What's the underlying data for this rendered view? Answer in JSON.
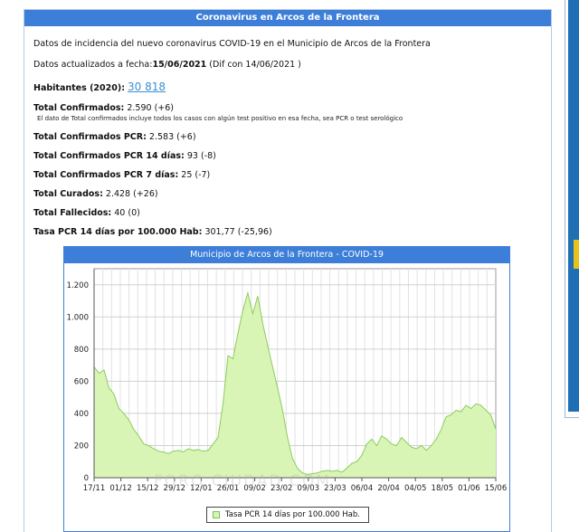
{
  "panel": {
    "title": "Coronavirus en Arcos de la Frontera"
  },
  "info": {
    "description": "Datos de incidencia del nuevo coronavirus COVID-19 en el Municipio de Arcos de la Frontera",
    "updated_label": "Datos actualizados a fecha:",
    "updated_date": "15/06/2021",
    "updated_diff": " (Dif con 14/06/2021 )",
    "population_label": "Habitantes (2020):",
    "population_value": "30 818"
  },
  "stats": {
    "total_confirmed_label": "Total Confirmados:",
    "total_confirmed_value": " 2.590 (+6)",
    "total_confirmed_note": "El dato de Total confirmados incluye todos los casos con algún test positivo en esa fecha, sea PCR o test serológico",
    "pcr_label": "Total Confirmados PCR:",
    "pcr_value": " 2.583 (+6)",
    "pcr14_label": "Total Confirmados PCR 14 días:",
    "pcr14_value": " 93 (-8)",
    "pcr7_label": "Total Confirmados PCR 7 días:",
    "pcr7_value": " 25 (-7)",
    "recovered_label": "Total Curados:",
    "recovered_value": " 2.428 (+26)",
    "deaths_label": "Total Fallecidos:",
    "deaths_value": " 40 (0)",
    "rate_label": "Tasa PCR 14 días por 100.000 Hab:",
    "rate_value": " 301,77 (-25,96)"
  },
  "chart_data": {
    "type": "area",
    "title": "Municipio de Arcos de la Frontera - COVID-19",
    "xlabel": "",
    "ylabel": "",
    "ylim": [
      0,
      1300
    ],
    "yticks": [
      "0",
      "200",
      "400",
      "600",
      "800",
      "1.000",
      "1.200"
    ],
    "ytick_values": [
      0,
      200,
      400,
      600,
      800,
      1000,
      1200
    ],
    "xticks": [
      "17/11",
      "01/12",
      "15/12",
      "29/12",
      "12/01",
      "26/01",
      "09/02",
      "23/02",
      "09/03",
      "23/03",
      "06/04",
      "20/04",
      "04/05",
      "18/05",
      "01/06",
      "15/06"
    ],
    "series": [
      {
        "name": "Tasa PCR 14 días por 100.000 Hab.",
        "values": [
          690,
          650,
          670,
          560,
          520,
          430,
          400,
          360,
          300,
          260,
          210,
          200,
          180,
          165,
          160,
          150,
          165,
          170,
          160,
          180,
          170,
          175,
          165,
          170,
          210,
          250,
          460,
          760,
          740,
          900,
          1040,
          1150,
          1020,
          1130,
          960,
          820,
          690,
          560,
          420,
          250,
          120,
          60,
          30,
          20,
          25,
          30,
          40,
          45,
          40,
          45,
          35,
          60,
          90,
          100,
          140,
          210,
          240,
          200,
          260,
          240,
          210,
          200,
          250,
          220,
          190,
          180,
          200,
          170,
          200,
          240,
          300,
          380,
          390,
          420,
          410,
          450,
          430,
          460,
          450,
          420,
          390,
          302
        ]
      }
    ],
    "grid": true,
    "legend": "bottom",
    "colors": {
      "fill": "#d9f5b6",
      "line": "#8ccc5a"
    }
  },
  "watermark": "FORO CIUDAD.COM"
}
